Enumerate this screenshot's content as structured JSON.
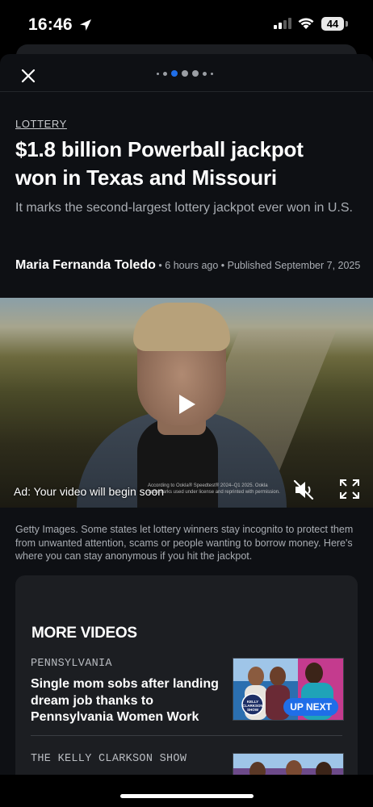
{
  "status_bar": {
    "time": "16:46",
    "battery": "44"
  },
  "article": {
    "category": "LOTTERY",
    "headline": "$1.8 billion Powerball jackpot won in Texas and Missouri",
    "subheadline": "It marks the second-largest lottery jackpot ever won in U.S.",
    "author": "Maria Fernanda Toledo",
    "meta": " • 6 hours ago • Published September 7, 2025",
    "caption": "Getty Images. Some states let lottery winners stay incognito to protect them from unwanted attention, scams or people wanting to borrow money. Here's where you can stay anonymous if you hit the jackpot."
  },
  "pager": {
    "active_index": 2,
    "dot_count": 7
  },
  "video_player": {
    "ad_text": "Ad: Your video will begin soon",
    "fine_print": "According to Ookla® Speedtest® 2024–Q1 2025. Ookla trademarks used under license and reprinted with permission."
  },
  "more_videos": {
    "title": "MORE VIDEOS",
    "items": [
      {
        "category": "PENNSYLVANIA",
        "title": "Single mom sobs after landing dream job thanks to Pennsylvania Women Work",
        "badge": "UP NEXT",
        "thumb_logo": "KELLY CLARKSON SHOW"
      },
      {
        "category": "THE KELLY CLARKSON SHOW"
      }
    ]
  },
  "colors": {
    "accent": "#1f6ee8",
    "sheet_bg": "#0e1014",
    "card_bg": "#1c1e22",
    "secondary_text": "#a9adb3"
  }
}
